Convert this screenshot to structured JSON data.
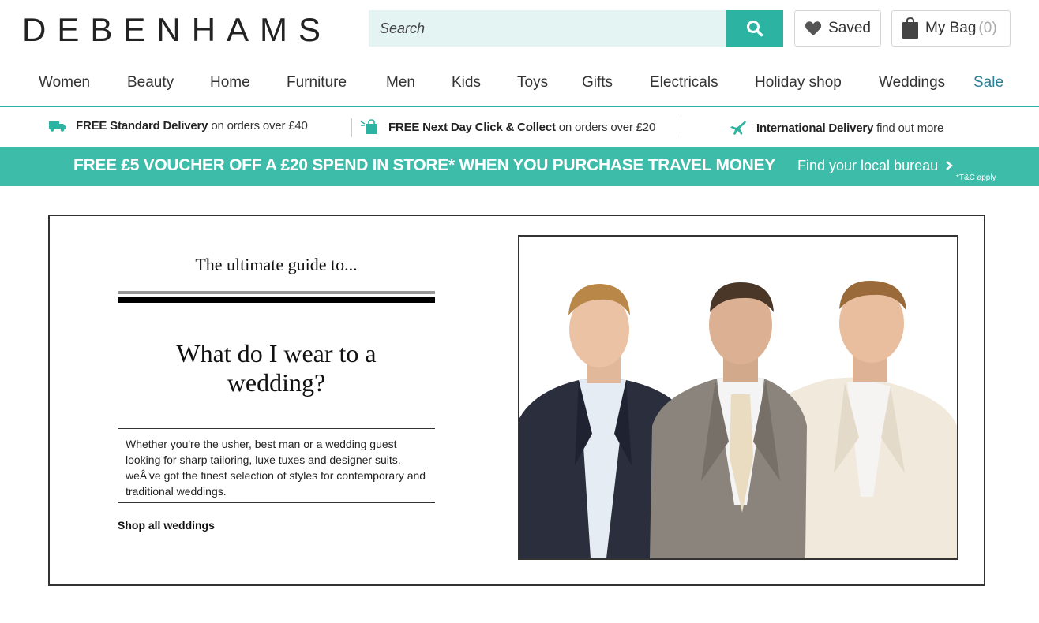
{
  "brand": {
    "name": "DEBENHAMS"
  },
  "search": {
    "placeholder": "Search"
  },
  "account": {
    "saved_label": "Saved",
    "bag_label": "My Bag",
    "bag_count": "(0)"
  },
  "nav": {
    "items": [
      "Women",
      "Beauty",
      "Home",
      "Furniture",
      "Men",
      "Kids",
      "Toys",
      "Gifts",
      "Electricals",
      "Holiday shop",
      "Weddings"
    ],
    "sale": "Sale"
  },
  "delivery": [
    {
      "bold": "FREE Standard Delivery",
      "rest": "on orders over £40"
    },
    {
      "bold": "FREE Next Day Click & Collect",
      "rest": "on orders over £20"
    },
    {
      "bold": "International Delivery",
      "rest": "find out more"
    }
  ],
  "promo": {
    "text": "FREE £5 VOUCHER OFF A £20 SPEND IN STORE* WHEN YOU PURCHASE TRAVEL MONEY",
    "link": "Find your local bureau",
    "tc": "*T&C apply"
  },
  "article": {
    "kicker": "The ultimate guide to...",
    "headline_line1": "What do I wear to a",
    "headline_line2": "wedding?",
    "body": "Whether you're the usher, best man or a wedding guest looking for sharp tailoring, luxe tuxes and designer suits, weÂ've got the finest selection of styles for contemporary and traditional weddings.",
    "cta": "Shop all weddings"
  },
  "colors": {
    "accent": "#2db3a1",
    "promo_bg": "#3dbca9",
    "sale": "#2a7e95",
    "search_bg": "#e3f4f2"
  },
  "icons": [
    "search-icon",
    "heart-icon",
    "bag-icon",
    "van-icon",
    "click-collect-icon",
    "plane-icon",
    "chevron-right-icon"
  ]
}
